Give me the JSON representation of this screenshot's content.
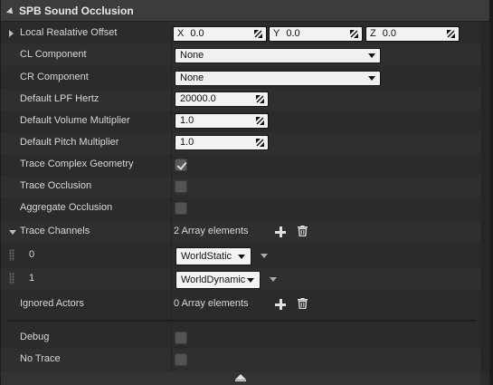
{
  "header": {
    "title": "SPB Sound Occlusion"
  },
  "rows": {
    "offset": {
      "label": "Local Realative Offset",
      "x_axis": "X",
      "x_value": "0.0",
      "y_axis": "Y",
      "y_value": "0.0",
      "z_axis": "Z",
      "z_value": "0.0"
    },
    "cl": {
      "label": "CL Component",
      "value": "None"
    },
    "cr": {
      "label": "CR Component",
      "value": "None"
    },
    "lpf": {
      "label": "Default LPF Hertz",
      "value": "20000.0"
    },
    "volume": {
      "label": "Default Volume Multiplier",
      "value": "1.0"
    },
    "pitch": {
      "label": "Default Pitch Multiplier",
      "value": "1.0"
    },
    "trace_complex": {
      "label": "Trace Complex Geometry",
      "checked": true
    },
    "trace_occlusion": {
      "label": "Trace Occlusion",
      "checked": false
    },
    "aggregate": {
      "label": "Aggregate Occlusion",
      "checked": false
    },
    "channels": {
      "label": "Trace Channels",
      "count_text": "2 Array elements"
    },
    "channel_0": {
      "index": "0",
      "value": "WorldStatic"
    },
    "channel_1": {
      "index": "1",
      "value": "WorldDynamic"
    },
    "ignored": {
      "label": "Ignored Actors",
      "count_text": "0 Array elements"
    },
    "debug": {
      "label": "Debug",
      "checked": false
    },
    "no_trace": {
      "label": "No Trace",
      "checked": false
    }
  },
  "icons": {
    "edit": "edit-arrows-icon",
    "add": "plus-icon",
    "delete": "trash-icon",
    "collapse": "chevron-up-icon"
  }
}
